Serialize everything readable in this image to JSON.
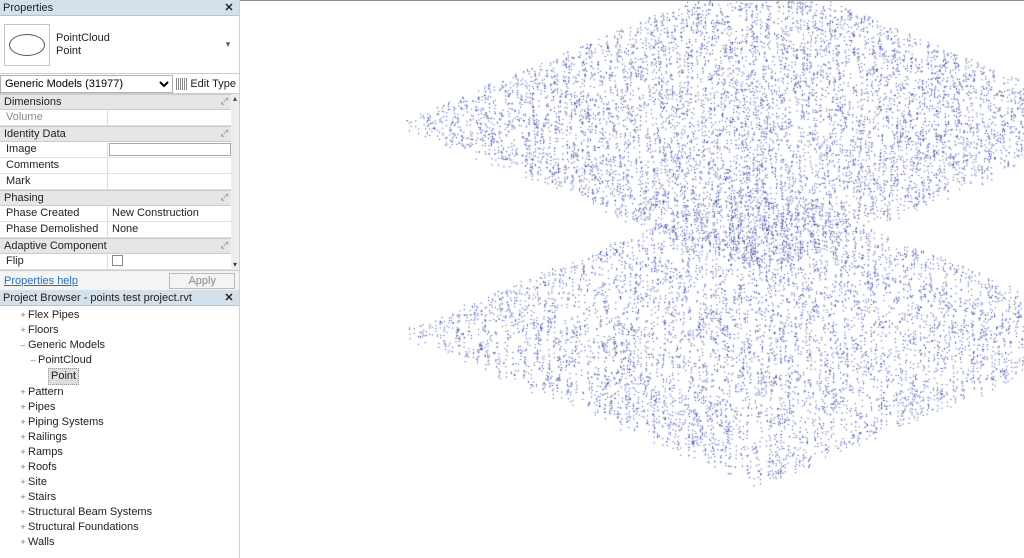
{
  "properties_panel": {
    "title": "Properties",
    "family_type": {
      "main": "PointCloud",
      "sub": "Point"
    },
    "selector": {
      "label": "Generic Models (31977)",
      "edit_type": "Edit Type"
    },
    "groups": [
      {
        "name": "Dimensions",
        "rows": [
          {
            "label": "Volume",
            "value": "",
            "dim": true
          }
        ]
      },
      {
        "name": "Identity Data",
        "rows": [
          {
            "label": "Image",
            "value": "",
            "box": true
          },
          {
            "label": "Comments",
            "value": ""
          },
          {
            "label": "Mark",
            "value": ""
          }
        ]
      },
      {
        "name": "Phasing",
        "rows": [
          {
            "label": "Phase Created",
            "value": "New Construction"
          },
          {
            "label": "Phase Demolished",
            "value": "None"
          }
        ]
      },
      {
        "name": "Adaptive Component",
        "rows": [
          {
            "label": "Flip",
            "value": "",
            "checkbox": true
          }
        ]
      }
    ],
    "help": "Properties help",
    "apply": "Apply"
  },
  "project_browser": {
    "title": "Project Browser - points test project.rvt",
    "items": [
      {
        "label": "Flex Pipes",
        "indent": 1,
        "twisty": "+"
      },
      {
        "label": "Floors",
        "indent": 1,
        "twisty": "+"
      },
      {
        "label": "Generic Models",
        "indent": 1,
        "twisty": "–"
      },
      {
        "label": "PointCloud",
        "indent": 2,
        "twisty": "–"
      },
      {
        "label": "Point",
        "indent": 3,
        "twisty": "",
        "selected": true
      },
      {
        "label": "Pattern",
        "indent": 1,
        "twisty": "+"
      },
      {
        "label": "Pipes",
        "indent": 1,
        "twisty": "+"
      },
      {
        "label": "Piping Systems",
        "indent": 1,
        "twisty": "+"
      },
      {
        "label": "Railings",
        "indent": 1,
        "twisty": "+"
      },
      {
        "label": "Ramps",
        "indent": 1,
        "twisty": "+"
      },
      {
        "label": "Roofs",
        "indent": 1,
        "twisty": "+"
      },
      {
        "label": "Site",
        "indent": 1,
        "twisty": "+"
      },
      {
        "label": "Stairs",
        "indent": 1,
        "twisty": "+"
      },
      {
        "label": "Structural Beam Systems",
        "indent": 1,
        "twisty": "+"
      },
      {
        "label": "Structural Foundations",
        "indent": 1,
        "twisty": "+"
      },
      {
        "label": "Walls",
        "indent": 1,
        "twisty": "+"
      }
    ]
  },
  "viewport": {
    "point_color": "#2a3b9c",
    "point_count": 9000
  }
}
